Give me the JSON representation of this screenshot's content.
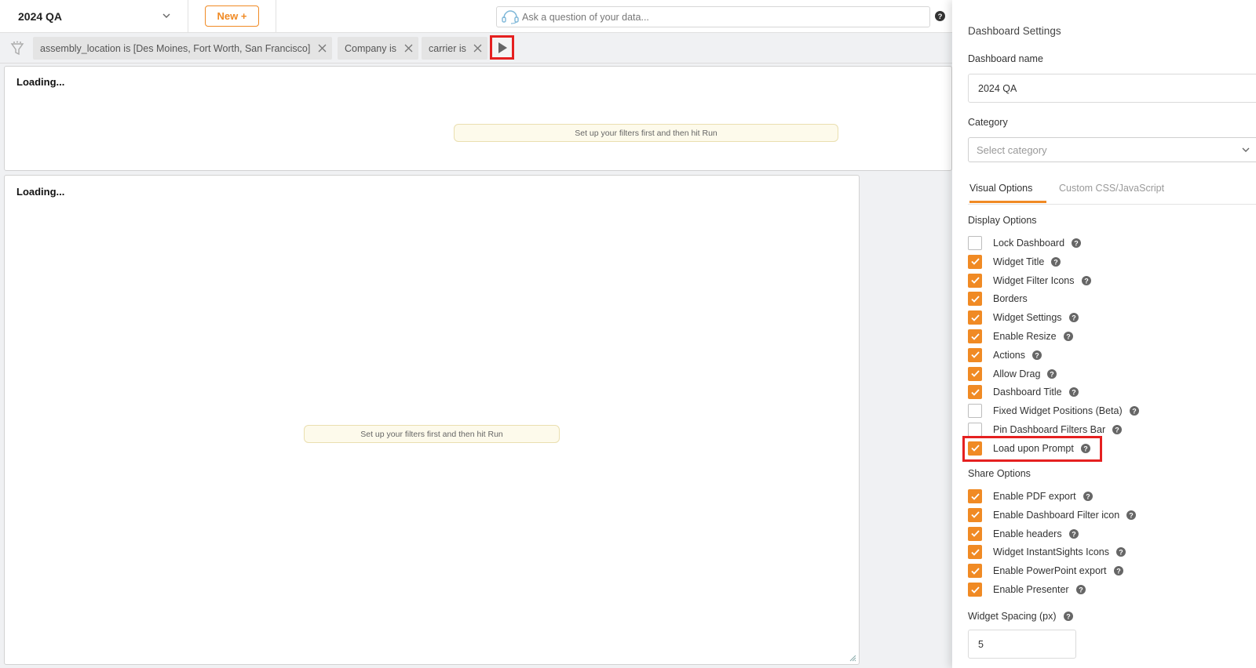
{
  "header": {
    "dashboard_title": "2024 QA",
    "new_button": "New +",
    "ask_placeholder": "Ask a question of your data..."
  },
  "filters": {
    "chips": [
      {
        "label": "assembly_location is [Des Moines, Fort Worth, San Francisco]"
      },
      {
        "label": "Company is"
      },
      {
        "label": "carrier is"
      }
    ]
  },
  "widgets": [
    {
      "loading": "Loading...",
      "notice": "Set up your filters first and then hit Run"
    },
    {
      "loading": "Loading...",
      "notice": "Set up your filters first and then hit Run"
    }
  ],
  "settings": {
    "title": "Dashboard Settings",
    "name_label": "Dashboard name",
    "name_value": "2024 QA",
    "category_label": "Category",
    "category_placeholder": "Select category",
    "tabs": [
      {
        "label": "Visual Options",
        "active": true
      },
      {
        "label": "Custom CSS/JavaScript",
        "active": false
      }
    ],
    "display_heading": "Display Options",
    "display_options": [
      {
        "label": "Lock Dashboard",
        "checked": false,
        "help": true
      },
      {
        "label": "Widget Title",
        "checked": true,
        "help": true
      },
      {
        "label": "Widget Filter Icons",
        "checked": true,
        "help": true
      },
      {
        "label": "Borders",
        "checked": true,
        "help": false
      },
      {
        "label": "Widget Settings",
        "checked": true,
        "help": true
      },
      {
        "label": "Enable Resize",
        "checked": true,
        "help": true
      },
      {
        "label": "Actions",
        "checked": true,
        "help": true
      },
      {
        "label": "Allow Drag",
        "checked": true,
        "help": true
      },
      {
        "label": "Dashboard Title",
        "checked": true,
        "help": true
      },
      {
        "label": "Fixed Widget Positions (Beta)",
        "checked": false,
        "help": true
      },
      {
        "label": "Pin Dashboard Filters Bar",
        "checked": false,
        "help": true
      },
      {
        "label": "Load upon Prompt",
        "checked": true,
        "help": true
      }
    ],
    "share_heading": "Share Options",
    "share_options": [
      {
        "label": "Enable PDF export",
        "checked": true,
        "help": true
      },
      {
        "label": "Enable Dashboard Filter icon",
        "checked": true,
        "help": true
      },
      {
        "label": "Enable headers",
        "checked": true,
        "help": true
      },
      {
        "label": "Widget InstantSights Icons",
        "checked": true,
        "help": true
      },
      {
        "label": "Enable PowerPoint export",
        "checked": true,
        "help": true
      },
      {
        "label": "Enable Presenter",
        "checked": true,
        "help": true
      }
    ],
    "spacing_label": "Widget Spacing (px)",
    "spacing_value": "5"
  },
  "colors": {
    "accent": "#f08a24",
    "highlight": "#e52020"
  },
  "icons": [
    "chevron-down-icon",
    "assistant-icon",
    "help-icon",
    "funnel-icon",
    "close-icon",
    "play-icon",
    "check-icon",
    "resize-grip-icon"
  ]
}
